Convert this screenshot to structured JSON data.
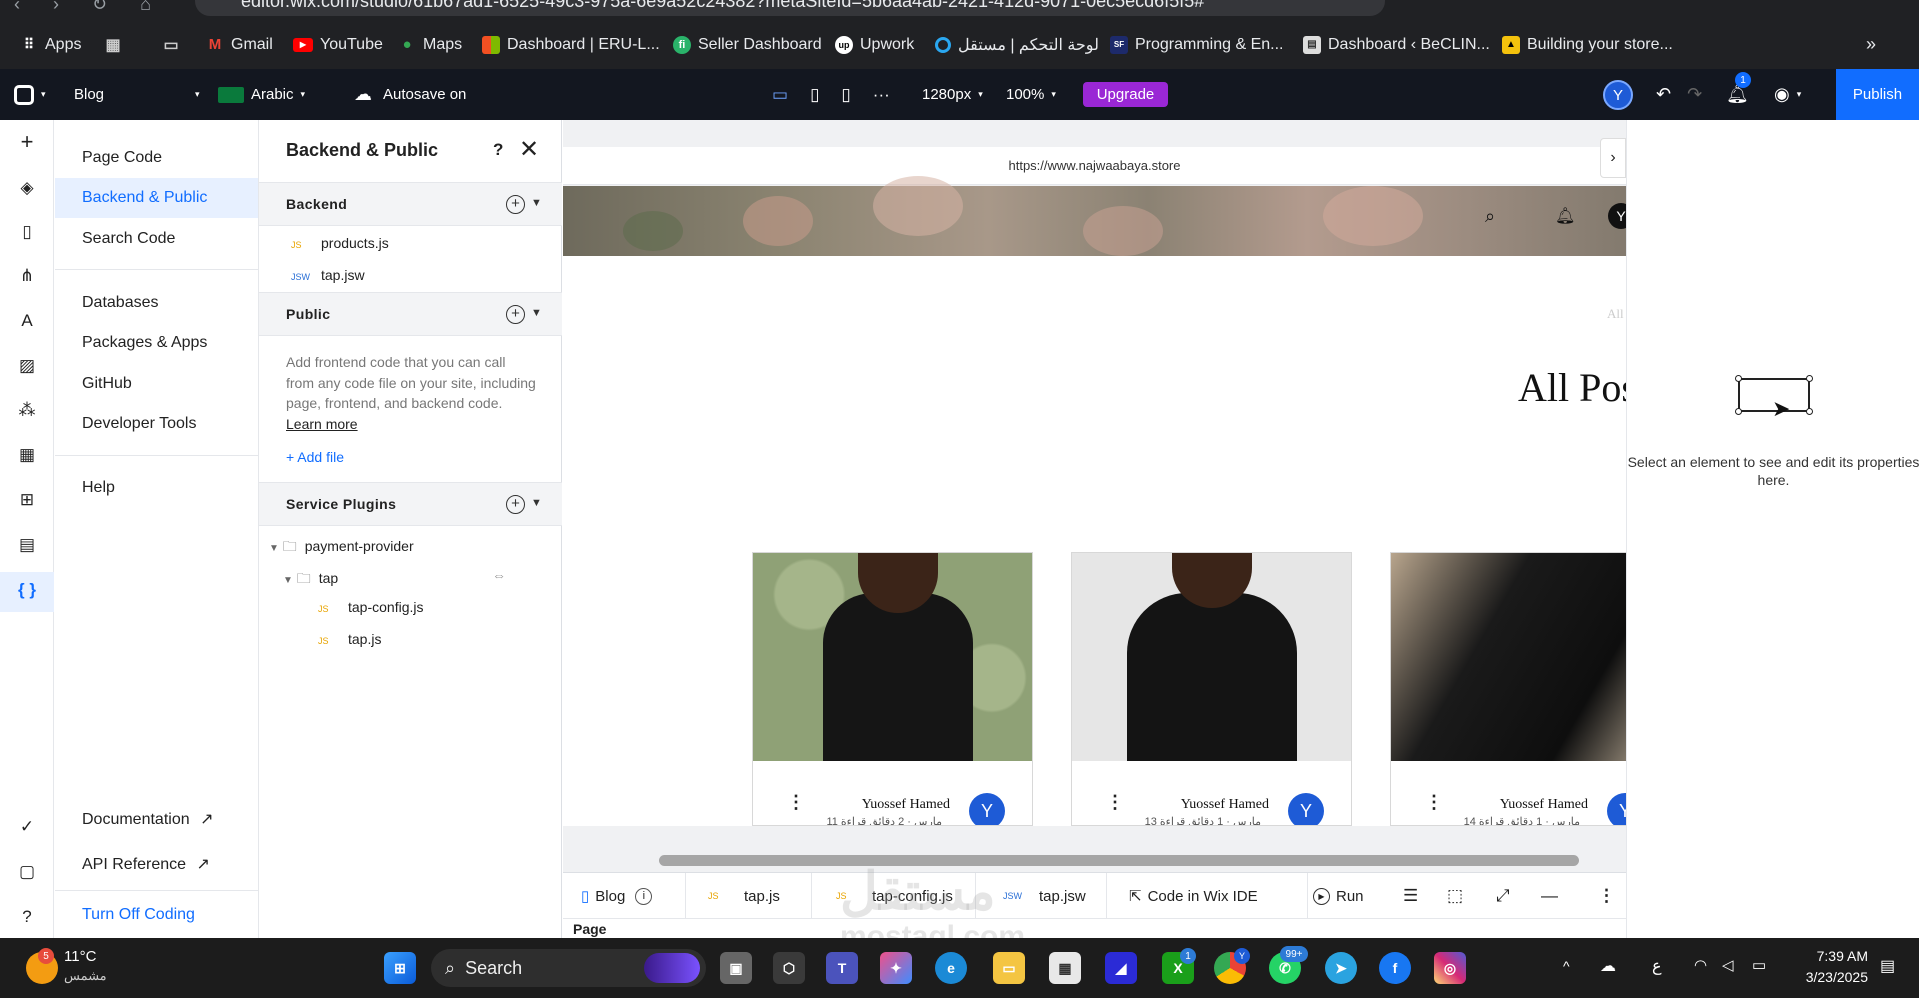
{
  "browser": {
    "url": "editor.wix.com/studio/61b67ad1-6525-49c3-975a-6e9a52c24382?metaSiteId=5b6aa4ab-2421-412d-9071-0ec5ecd6f5f5#",
    "bookmarks": [
      {
        "label": "Apps",
        "icon": "apps-grid-icon"
      },
      {
        "label": "",
        "icon": "grid-icon"
      },
      {
        "label": "",
        "icon": "folder-icon"
      },
      {
        "label": "Gmail",
        "icon": "gmail-icon"
      },
      {
        "label": "YouTube",
        "icon": "youtube-icon"
      },
      {
        "label": "Maps",
        "icon": "maps-pin-icon"
      },
      {
        "label": "Dashboard | ERU-L...",
        "icon": "microsoft-icon"
      },
      {
        "label": "Seller Dashboard",
        "icon": "seller-icon"
      },
      {
        "label": "Upwork",
        "icon": "upwork-icon"
      },
      {
        "label": "لوحة التحكم | مستقل",
        "icon": "mostaql-icon"
      },
      {
        "label": "Programming & En...",
        "icon": "programming-icon"
      },
      {
        "label": "Dashboard ‹ BeCLIN...",
        "icon": "becline-icon"
      },
      {
        "label": "Building your store...",
        "icon": "store-icon"
      }
    ]
  },
  "topbar": {
    "site_name": "Blog",
    "language": "Arabic",
    "autosave": "Autosave on",
    "breakpoint": "1280px",
    "zoom": "100%",
    "upgrade": "Upgrade",
    "avatar": "Y",
    "notifications": "1",
    "publish": "Publish"
  },
  "nav": {
    "items": [
      "Page Code",
      "Backend & Public",
      "Search Code",
      "Databases",
      "Packages & Apps",
      "GitHub",
      "Developer Tools",
      "Help"
    ],
    "footer": [
      "Documentation",
      "API Reference",
      "Turn Off Coding"
    ]
  },
  "panel": {
    "title": "Backend & Public",
    "help": "?",
    "backend_title": "Backend",
    "backend_files": [
      {
        "type": "JS",
        "name": "products.js"
      },
      {
        "type": "JSW",
        "name": "tap.jsw"
      }
    ],
    "public_title": "Public",
    "public_desc": "Add frontend code that you can call from any code file on your site, including page, frontend, and backend code.",
    "learn_more": "Learn more",
    "add_file": "+ Add file",
    "plugins_title": "Service Plugins",
    "plugin_folder": "payment-provider",
    "plugin_subfolder": "tap",
    "plugin_files": [
      {
        "type": "JS",
        "name": "tap-config.js"
      },
      {
        "type": "JS",
        "name": "tap.js"
      }
    ]
  },
  "canvas": {
    "site_url": "https://www.najwaabaya.store",
    "header_avatar": "Y",
    "faint_text": "All",
    "heading": "All Pos",
    "cards": [
      {
        "author": "Yuossef Hamed",
        "meta": "11 مارس · 2 دقائق قراءة",
        "avatar": "Y"
      },
      {
        "author": "Yuossef Hamed",
        "meta": "13 مارس · 1 دقائق قراءة",
        "avatar": "Y"
      },
      {
        "author": "Yuossef Hamed",
        "meta": "14 مارس · 1 دقائق قراءة",
        "avatar": "Y"
      }
    ]
  },
  "bottombar": {
    "tabs": [
      {
        "label": "Blog"
      },
      {
        "type": "JS",
        "label": "tap.js"
      },
      {
        "type": "JS",
        "label": "tap-config.js"
      },
      {
        "type": "JSW",
        "label": "tap.jsw"
      }
    ],
    "code_ide": "Code in Wix IDE",
    "run": "Run",
    "page_label": "Page"
  },
  "props": {
    "message": "Select an element to see and edit its properties here."
  },
  "taskbar": {
    "weather_temp": "11°C",
    "weather_desc": "مشمس",
    "weather_badge": "5",
    "search": "Search",
    "time": "7:39 AM",
    "date": "3/23/2025",
    "lang": "ع",
    "xbox_badge": "1",
    "whatsapp_badge": "99+",
    "chrome_badge": "Y"
  },
  "watermark": {
    "line1": "مستقل",
    "line2": "mostaql.com"
  },
  "colors": {
    "accent": "#116dff",
    "upgrade": "#9a27d5",
    "active_bg": "#e7f0ff",
    "topbar": "#131720"
  }
}
